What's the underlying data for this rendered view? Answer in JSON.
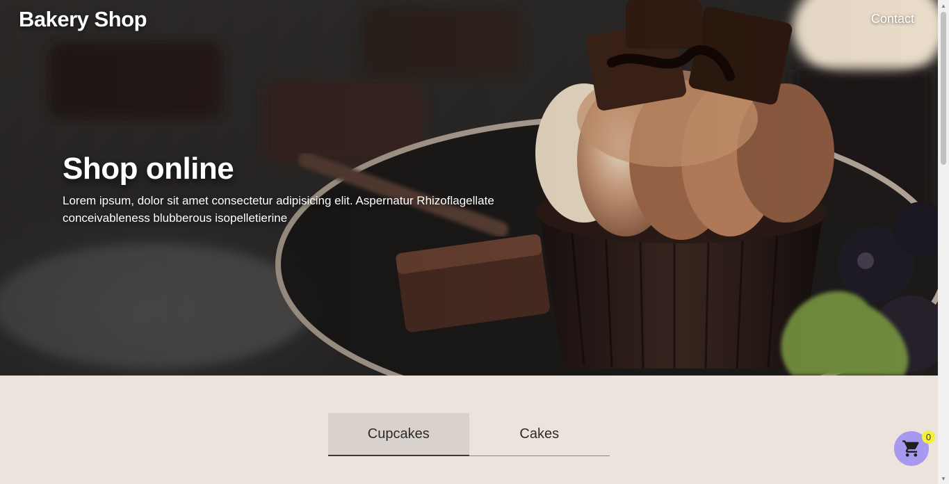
{
  "header": {
    "brand": "Bakery Shop",
    "nav": {
      "contact_label": "Contact"
    }
  },
  "hero": {
    "title": "Shop online",
    "subtitle": "Lorem ipsum, dolor sit amet consectetur adipisicing elit. Aspernatur Rhizoflagellate conceivableness blubberous isopelletierine"
  },
  "tabs": [
    {
      "label": "Cupcakes",
      "active": true
    },
    {
      "label": "Cakes",
      "active": false
    }
  ],
  "cart": {
    "icon": "cart-icon",
    "count": "0",
    "colors": {
      "button": "#a899f0",
      "badge": "#f5ef3a"
    }
  },
  "colors": {
    "page_background": "#ece3dd",
    "active_tab": "#d9d1cb"
  }
}
